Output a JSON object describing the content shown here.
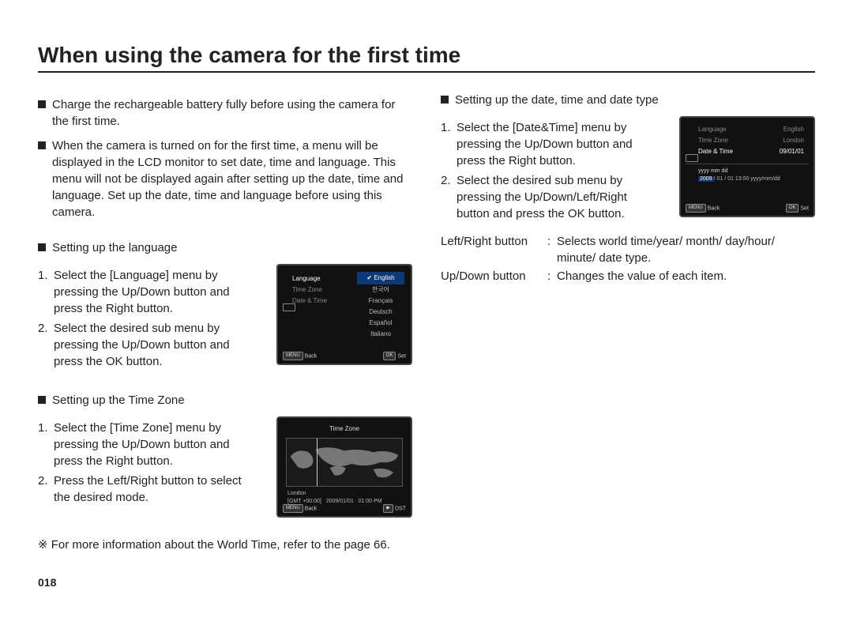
{
  "title": "When using the camera for the first time",
  "page_number": "018",
  "intro": [
    "Charge the rechargeable battery fully before using the camera for the first time.",
    "When the camera is turned on for the first time, a menu will be displayed in the LCD monitor to set date, time and language. This menu will not be displayed again after setting up the date, time and language. Set up the date, time and language before using this camera."
  ],
  "lang": {
    "heading": "Setting up the language",
    "steps": [
      "Select the [Language] menu by pressing the Up/Down button and press the Right button.",
      "Select the desired sub menu by pressing the Up/Down button and press the OK button."
    ],
    "screen": {
      "left_items": [
        "Language",
        "Time Zone",
        "Date & Time"
      ],
      "right_items": [
        "English",
        "한국어",
        "Français",
        "Deutsch",
        "Español",
        "Italiano"
      ],
      "check": "✔",
      "bottom_left_tag": "MENU",
      "bottom_left": "Back",
      "bottom_right_tag": "OK",
      "bottom_right": "Set"
    }
  },
  "tz": {
    "heading": "Setting up the Time Zone",
    "steps": [
      "Select the [Time Zone] menu by pressing the Up/Down button and press the Right button.",
      "Press the Left/Right button to select the desired mode."
    ],
    "note_prefix": "※ ",
    "note": "For more information about the World Time, refer to the page 66.",
    "screen": {
      "title": "Time Zone",
      "city": "London",
      "gmt": "[GMT +00:00]",
      "date": "2009/01/01",
      "time": "01:00 PM",
      "bottom_left_tag": "MENU",
      "bottom_left": "Back",
      "bottom_right_tag": "▶",
      "bottom_right": "DST"
    }
  },
  "dt": {
    "heading": "Setting up the date, time and date type",
    "steps": [
      "Select the [Date&Time] menu by pressing the Up/Down button and press the Right button.",
      "Select the desired sub menu by pressing the Up/Down/Left/Right button and press the OK button."
    ],
    "desc": [
      {
        "label": "Left/Right button",
        "text": "Selects world time/year/ month/ day/hour/ minute/ date type."
      },
      {
        "label": "Up/Down button",
        "text": "Changes the value of each item."
      }
    ],
    "screen": {
      "rows": [
        {
          "l": "Language",
          "r": "English"
        },
        {
          "l": "Time Zone",
          "r": "London"
        },
        {
          "l": "Date & Time",
          "r": "09/01/01"
        }
      ],
      "fmt_line": "yyyy mm dd",
      "value_line_year": "2009",
      "value_line_rest": "/ 01 / 01   13:00   yyyy/mm/dd",
      "bottom_left_tag": "MENU",
      "bottom_left": "Back",
      "bottom_right_tag": "OK",
      "bottom_right": "Set"
    }
  }
}
